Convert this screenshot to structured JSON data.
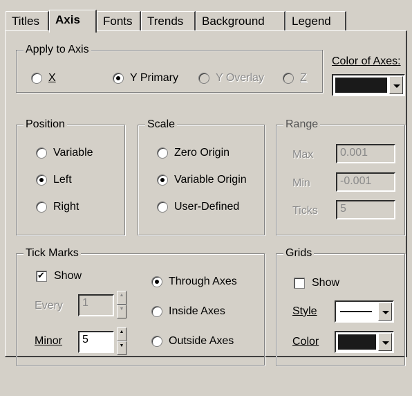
{
  "tabs": [
    "Titles",
    "Axis",
    "Fonts",
    "Trends",
    "Background",
    "Legend"
  ],
  "apply_to_axis": {
    "legend": "Apply to Axis",
    "options": [
      "X",
      "Y Primary",
      "Y Overlay",
      "Z"
    ],
    "selected": "Y Primary"
  },
  "color_of_axes": {
    "label": "Color of Axes:",
    "color": "#1a1a1a"
  },
  "position": {
    "legend": "Position",
    "options": [
      "Variable",
      "Left",
      "Right"
    ],
    "selected": "Left"
  },
  "scale": {
    "legend": "Scale",
    "options": [
      "Zero Origin",
      "Variable Origin",
      "User-Defined"
    ],
    "selected": "Variable Origin"
  },
  "range": {
    "legend": "Range",
    "max_label": "Max",
    "max_value": "0.001",
    "min_label": "Min",
    "min_value": "-0.001",
    "ticks_label": "Ticks",
    "ticks_value": "5"
  },
  "tick_marks": {
    "legend": "Tick Marks",
    "show_label": "Show",
    "show_checked": true,
    "every_label": "Every",
    "every_value": "1",
    "minor_label": "Minor",
    "minor_value": "5",
    "options": [
      "Through Axes",
      "Inside Axes",
      "Outside Axes"
    ],
    "selected": "Through Axes"
  },
  "grids": {
    "legend": "Grids",
    "show_label": "Show",
    "show_checked": false,
    "style_label": "Style",
    "color_label": "Color",
    "color": "#1a1a1a"
  }
}
